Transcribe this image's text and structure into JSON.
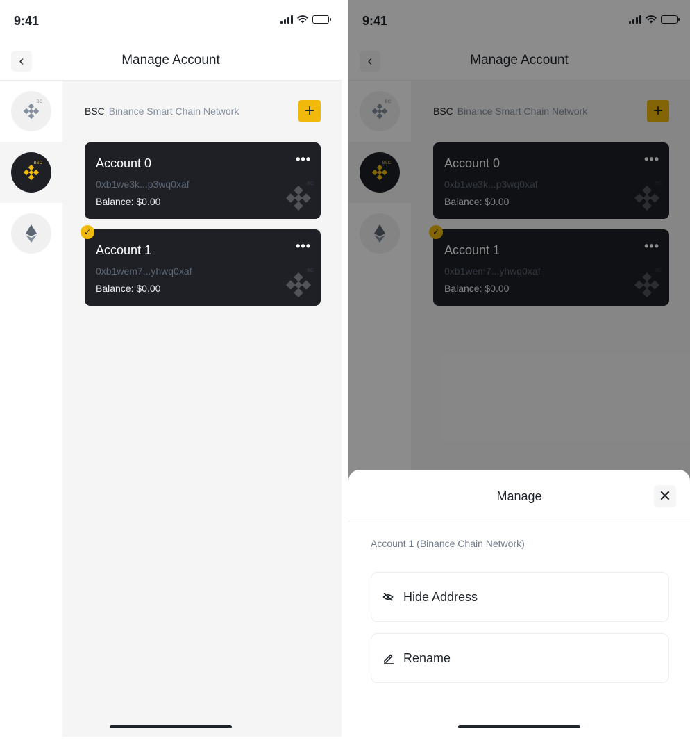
{
  "status_bar": {
    "time": "9:41"
  },
  "nav": {
    "back_symbol": "‹",
    "title": "Manage Account"
  },
  "chains": [
    {
      "icon": "bc-chain-icon",
      "tag": "BC",
      "active": false
    },
    {
      "icon": "bsc-chain-icon",
      "tag": "BSC",
      "active": true
    },
    {
      "icon": "eth-chain-icon",
      "tag": "",
      "active": false
    }
  ],
  "network": {
    "short": "BSC",
    "full": "Binance Smart Chain Network",
    "add_symbol": "+"
  },
  "accounts": [
    {
      "name": "Account 0",
      "address": "0xb1we3k...p3wq0xaf",
      "balance": "Balance: $0.00",
      "watermark_tag": "BC",
      "selected": false
    },
    {
      "name": "Account 1",
      "address": "0xb1wem7...yhwq0xaf",
      "balance": "Balance: $0.00",
      "watermark_tag": "BC",
      "selected": true
    }
  ],
  "more_symbol": "•••",
  "manage_sheet": {
    "title": "Manage",
    "close_symbol": "✕",
    "subtitle": "Account 1 (Binance Chain Network)",
    "options": [
      {
        "label": "Hide Address",
        "icon": "eye-off-icon"
      },
      {
        "label": "Rename",
        "icon": "pencil-icon"
      }
    ]
  },
  "colors": {
    "brand_yellow": "#f0b90b",
    "card_dark": "#1e2026",
    "text_primary": "#1e2329",
    "text_secondary": "#848e9c",
    "background_gray": "#f5f5f5"
  }
}
